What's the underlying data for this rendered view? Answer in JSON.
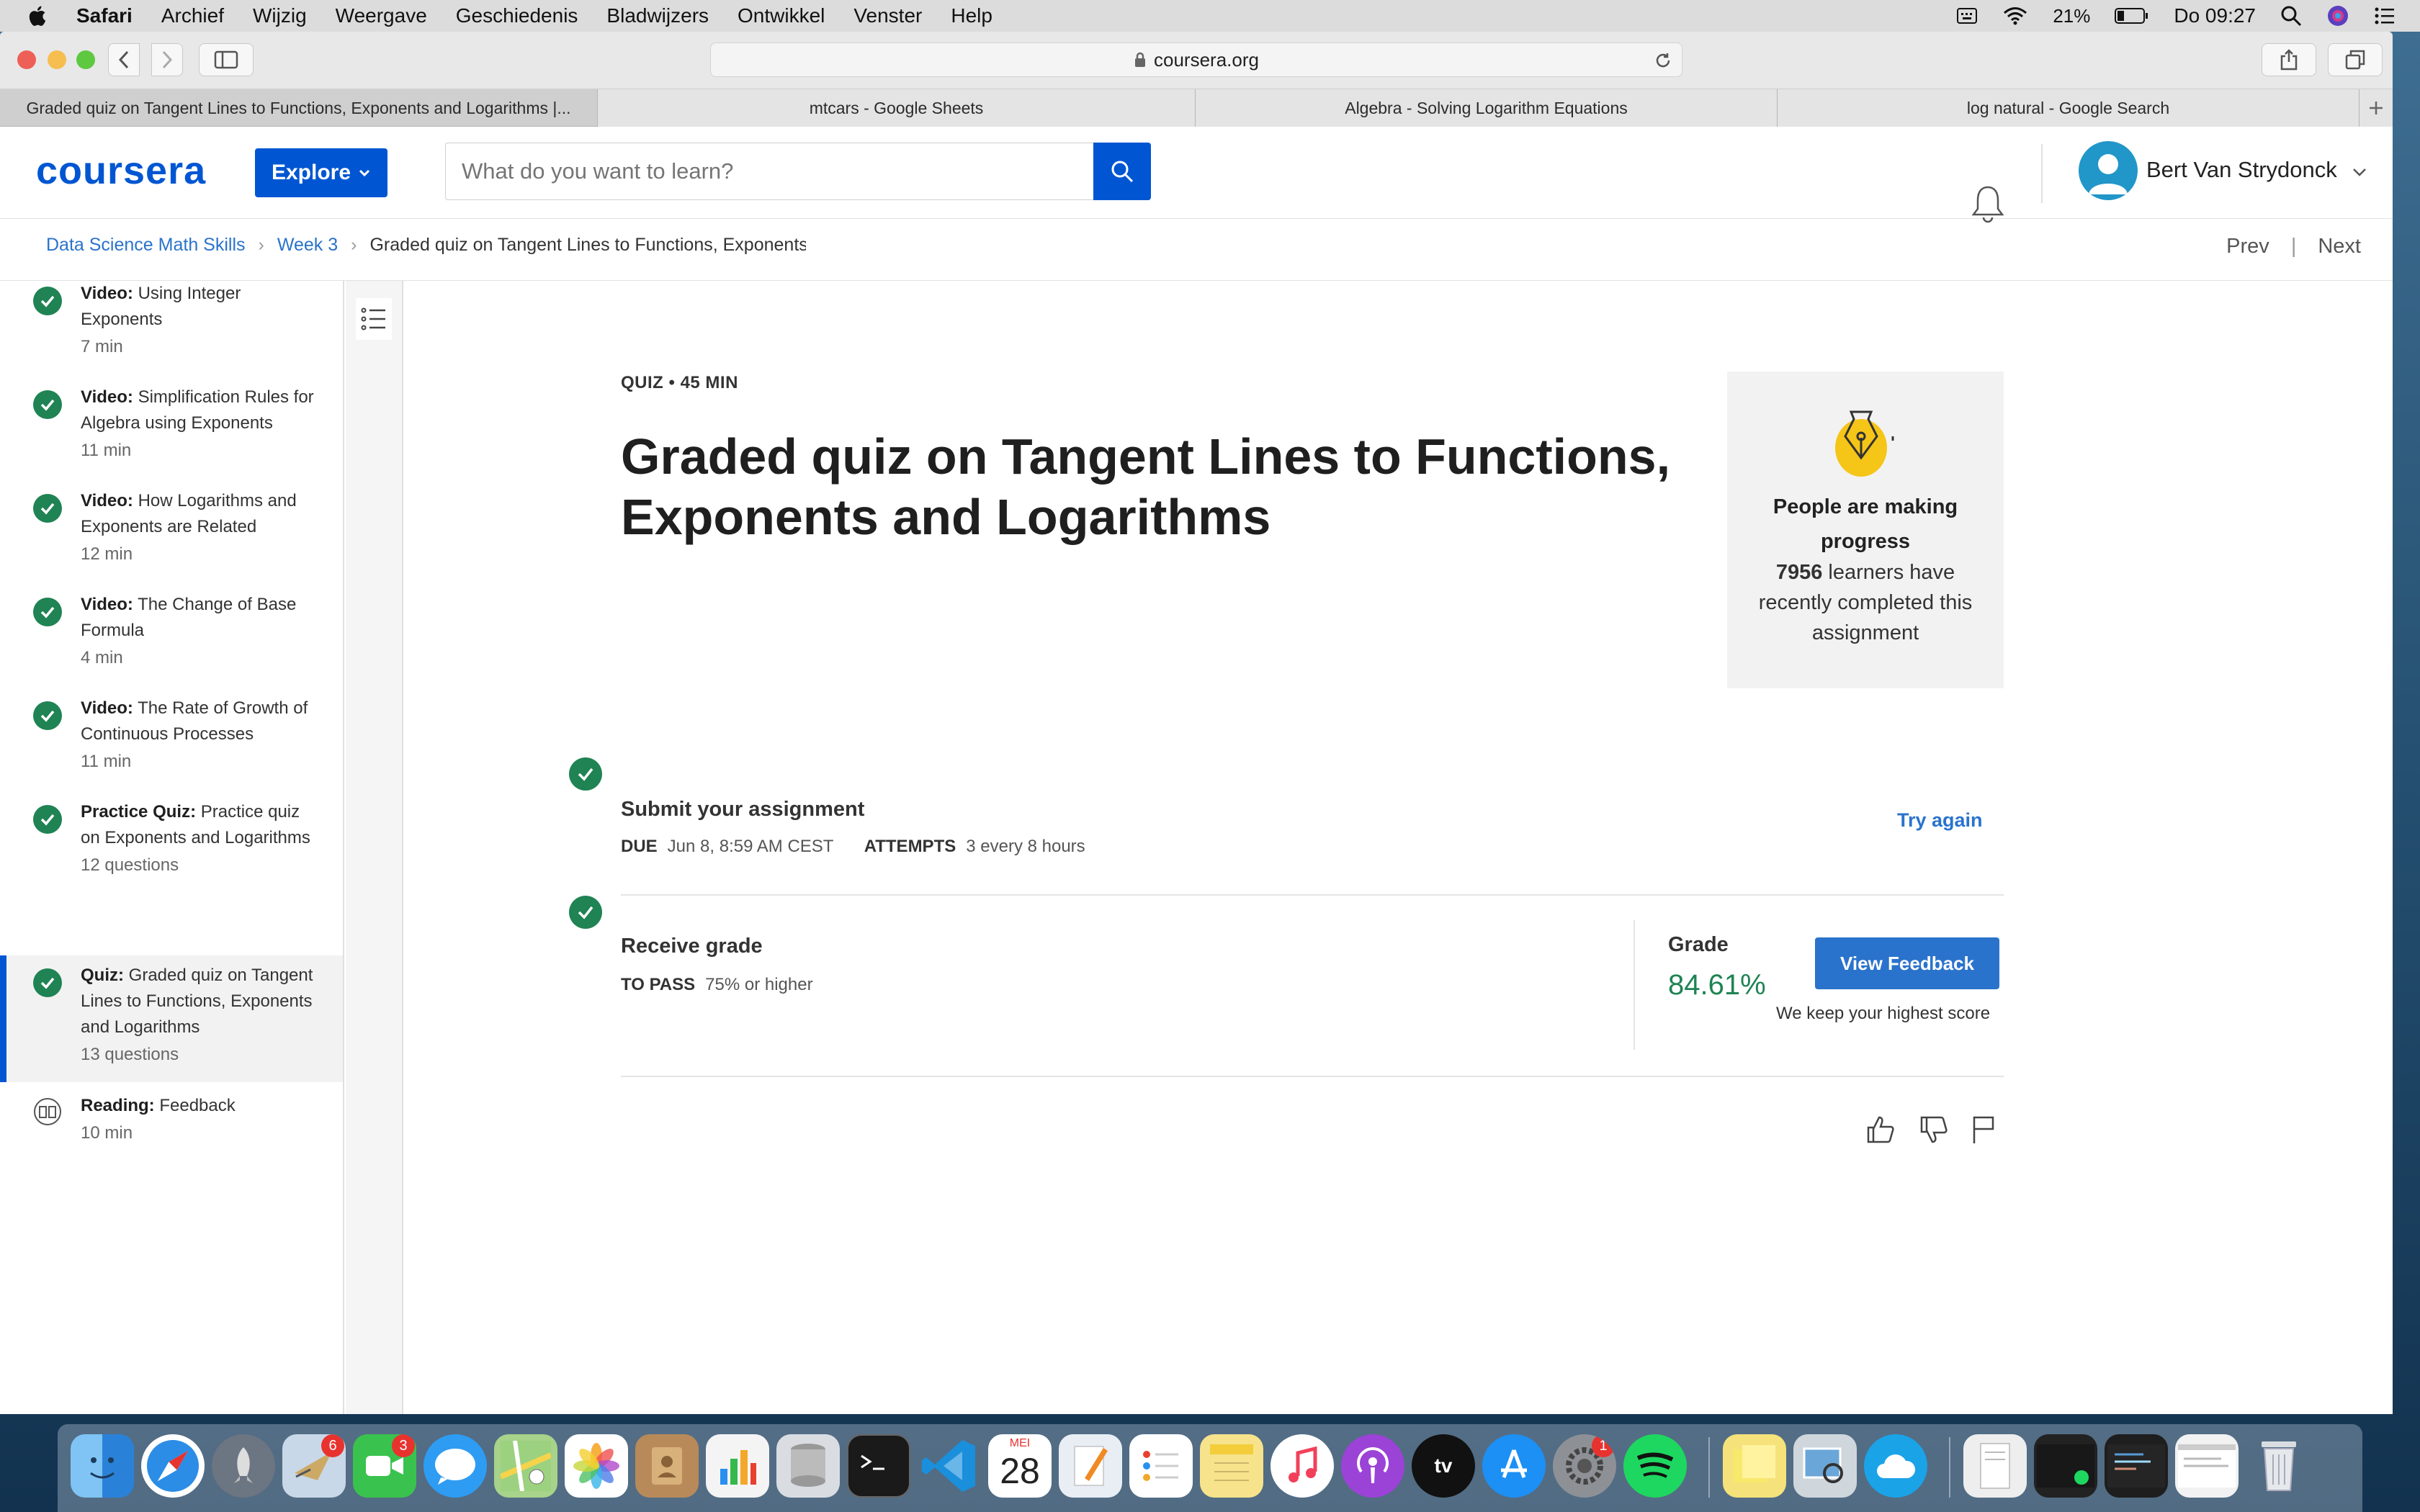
{
  "menubar": {
    "app": "Safari",
    "menus": [
      "Archief",
      "Wijzig",
      "Weergave",
      "Geschiedenis",
      "Bladwijzers",
      "Ontwikkel",
      "Venster",
      "Help"
    ],
    "battery": "21%",
    "clock": "Do 09:27"
  },
  "browser": {
    "url": "coursera.org",
    "tabs": [
      "Graded quiz on Tangent Lines to Functions, Exponents and Logarithms |...",
      "mtcars - Google Sheets",
      "Algebra - Solving Logarithm Equations",
      "log natural - Google Search"
    ]
  },
  "header": {
    "logo": "coursera",
    "explore": "Explore",
    "search_placeholder": "What do you want to learn?",
    "user": "Bert Van Strydonck"
  },
  "breadcrumb": {
    "course": "Data Science Math Skills",
    "week": "Week 3",
    "current": "Graded quiz on Tangent Lines to Functions, Exponents and Logarithms",
    "prev": "Prev",
    "next": "Next",
    "divider": "|"
  },
  "sidebar": {
    "items": [
      {
        "kind": "Video:",
        "title": "Using Integer Exponents",
        "duration": "7 min"
      },
      {
        "kind": "Video:",
        "title": "Simplification Rules for Algebra using Exponents",
        "duration": "11 min"
      },
      {
        "kind": "Video:",
        "title": "How Logarithms and Exponents are Related",
        "duration": "12 min"
      },
      {
        "kind": "Video:",
        "title": "The Change of Base Formula",
        "duration": "4 min"
      },
      {
        "kind": "Video:",
        "title": "The Rate of Growth of Continuous Processes",
        "duration": "11 min"
      },
      {
        "kind": "Practice Quiz:",
        "title": "Practice quiz on Exponents and Logarithms",
        "duration": "12 questions"
      },
      {
        "kind": "Quiz:",
        "title": "Graded quiz on Tangent Lines to Functions, Exponents and Logarithms",
        "duration": "13 questions"
      },
      {
        "kind": "Reading:",
        "title": "Feedback",
        "duration": "10 min"
      }
    ]
  },
  "quiz": {
    "meta": "QUIZ • 45 MIN",
    "title": "Graded quiz on Tangent Lines to Functions, Exponents and Logarithms"
  },
  "progress_card": {
    "heading": "People are making progress",
    "count": "7956",
    "text": "learners have recently completed this assignment"
  },
  "submit": {
    "title": "Submit your assignment",
    "due_label": "DUE",
    "due_value": "Jun 8, 8:59 AM CEST",
    "attempts_label": "ATTEMPTS",
    "attempts_value": "3 every 8 hours",
    "action": "Try again"
  },
  "receive": {
    "title": "Receive grade",
    "pass_label": "TO PASS",
    "pass_value": "75% or higher",
    "grade_label": "Grade",
    "grade_value": "84.61%",
    "feedback_button": "View Feedback",
    "note": "We keep your highest score"
  },
  "dock": {
    "calendar_month": "MEI",
    "calendar_day": "28",
    "badges": {
      "mail": "6",
      "facetime": "3",
      "preferences": "1"
    }
  },
  "colors": {
    "brand": "#0056d2",
    "success": "#1f8354",
    "link": "#2a73cc"
  }
}
